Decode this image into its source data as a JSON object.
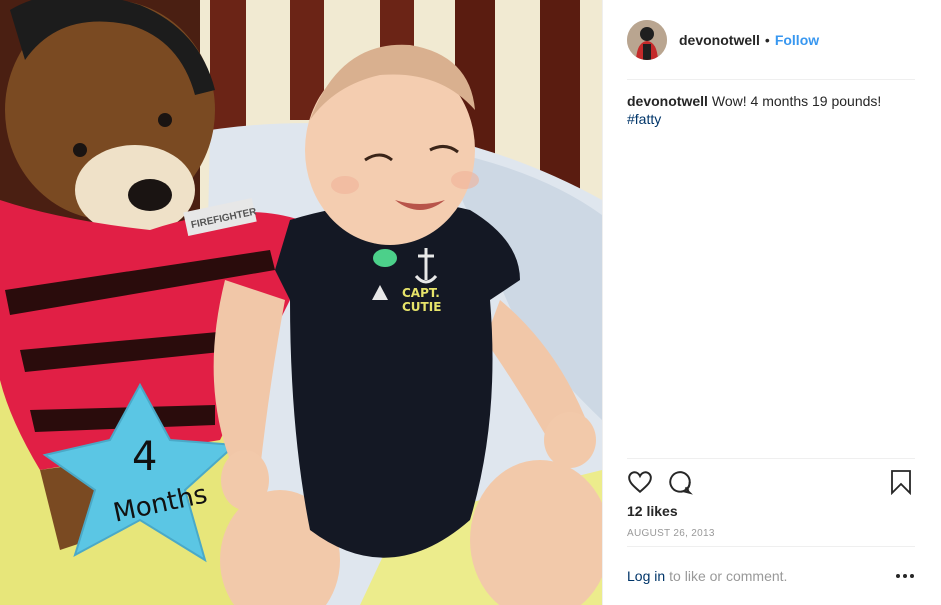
{
  "post": {
    "username": "devonotwell",
    "separator": "•",
    "follow_label": "Follow",
    "caption_user": "devonotwell",
    "caption_text": "Wow! 4 months 19 pounds!",
    "hashtag": "#fatty",
    "likes": "12 likes",
    "date": "AUGUST 26, 2013",
    "login_link": "Log in",
    "login_rest": "to like or comment."
  },
  "photo": {
    "shirt_text_line1": "CAPT.",
    "shirt_text_line2": "CUTIE",
    "star_number": "4",
    "star_word": "Months",
    "badge_text": "FIREFIGHTER"
  },
  "icons": {
    "like": "heart-icon",
    "comment": "comment-icon",
    "save": "bookmark-icon",
    "more": "more-dots-icon"
  },
  "colors": {
    "link_blue": "#3897f0",
    "hashtag_blue": "#003569",
    "muted_gray": "#999999",
    "divider": "#efefef"
  }
}
